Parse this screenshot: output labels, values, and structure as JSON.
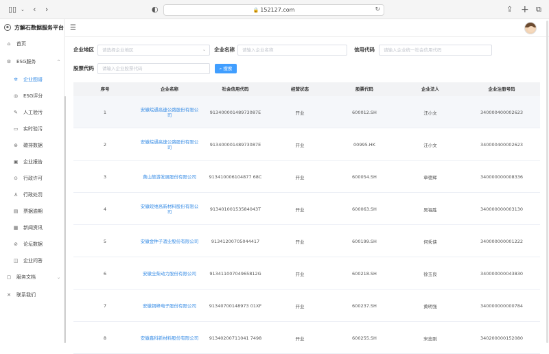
{
  "browser": {
    "url": "152127.com",
    "lock_icon": "◐"
  },
  "sidebar": {
    "brand": "方解石数据服务平台",
    "items": [
      {
        "label": "首页",
        "icon": "home-icon"
      },
      {
        "label": "ESG服务",
        "icon": "esg-icon"
      },
      {
        "label": "企业图谱",
        "icon": "graph-icon"
      },
      {
        "label": "ESG评分",
        "icon": "score-icon"
      },
      {
        "label": "人工验污",
        "icon": "inspect-icon"
      },
      {
        "label": "实时验污",
        "icon": "realtime-icon"
      },
      {
        "label": "碳排数据",
        "icon": "carbon-icon"
      },
      {
        "label": "企业报告",
        "icon": "report-icon"
      },
      {
        "label": "行政许可",
        "icon": "permit-icon"
      },
      {
        "label": "行政处罚",
        "icon": "penalty-icon"
      },
      {
        "label": "票据逾期",
        "icon": "bill-icon"
      },
      {
        "label": "新闻资讯",
        "icon": "news-icon"
      },
      {
        "label": "论坛数据",
        "icon": "forum-icon"
      },
      {
        "label": "企业问答",
        "icon": "qa-icon"
      },
      {
        "label": "服务文档",
        "icon": "docs-icon"
      },
      {
        "label": "联系我们",
        "icon": "contact-icon"
      }
    ]
  },
  "filters": {
    "region_label": "企业地区",
    "region_placeholder": "请选择企业地区",
    "name_label": "企业名称",
    "name_placeholder": "请输入企业名称",
    "credit_label": "信用代码",
    "credit_placeholder": "请输入企业统一社会信用代码",
    "stock_label": "股票代码",
    "stock_placeholder": "请输入企业股票代码",
    "search_button": "搜索"
  },
  "table": {
    "headers": [
      "序号",
      "企业名称",
      "社会信用代码",
      "经营状态",
      "股票代码",
      "企业法人",
      "企业注册号码"
    ],
    "rows": [
      [
        "1",
        "安徽皖通高速公路股份有限公司",
        "91340000148973087E",
        "开业",
        "600012.SH",
        "汪小文",
        "340000400002623"
      ],
      [
        "2",
        "安徽皖通高速公路股份有限公司",
        "91340000148973087E",
        "开业",
        "00995.HK",
        "汪小文",
        "340000400002623"
      ],
      [
        "3",
        "黄山旅游发展股份有限公司",
        "913410006104877 68C",
        "开业",
        "600054.SH",
        "章德辉",
        "340000000008336"
      ],
      [
        "4",
        "安徽皖维高新材料股份有限公司",
        "91340100153584043T",
        "开业",
        "600063.SH",
        "吴福胜",
        "340000000003130"
      ],
      [
        "5",
        "安徽金种子酒业股份有限公司",
        "91341200705044417",
        "开业",
        "600199.SH",
        "何秀侠",
        "340000000001222"
      ],
      [
        "6",
        "安徽全柴动力股份有限公司",
        "91341100704965812G",
        "开业",
        "600218.SH",
        "徐玉良",
        "340000000043830"
      ],
      [
        "7",
        "安徽铜峰电子股份有限公司",
        "91340700148973 01XF",
        "开业",
        "600237.SH",
        "黄明强",
        "340000000000784"
      ],
      [
        "8",
        "安徽鑫科新材料股份有限公司",
        "91340200711041 7498",
        "开业",
        "600255.SH",
        "宋志刚",
        "340200000152080"
      ]
    ]
  }
}
